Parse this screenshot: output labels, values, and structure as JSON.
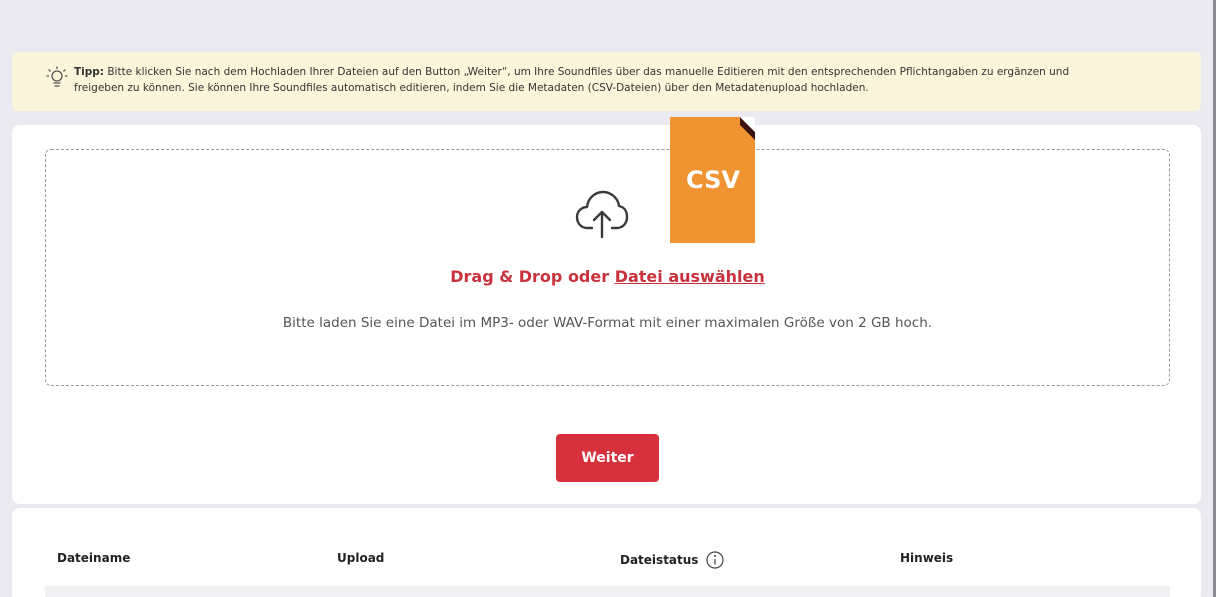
{
  "tip": {
    "label": "Tipp:",
    "text_line1": "Bitte klicken Sie nach dem Hochladen Ihrer Dateien auf den Button „Weiter“, um Ihre Soundfiles über das manuelle Editieren mit den entsprechenden Pflichtangaben zu ergänzen und",
    "text_line2": "freigeben zu können. Sie können Ihre Soundfiles automatisch editieren, indem Sie die Metadaten (CSV-Dateien) über den Metadatenupload hochladen.",
    "icon": "lightbulb-icon"
  },
  "upload": {
    "title_prefix": "Drag & Drop oder ",
    "title_link": "Datei auswählen",
    "hint": "Bitte laden Sie eine Datei im MP3- oder WAV-Format mit einer maximalen Größe von 2 GB hoch.",
    "icon": "cloud-upload-icon",
    "csv_badge": "CSV",
    "csv_color": "#ef9431",
    "continue_label": "Weiter",
    "accent": "#d6303c"
  },
  "table": {
    "columns": [
      "Dateiname",
      "Upload",
      "Dateistatus",
      "Hinweis"
    ]
  }
}
